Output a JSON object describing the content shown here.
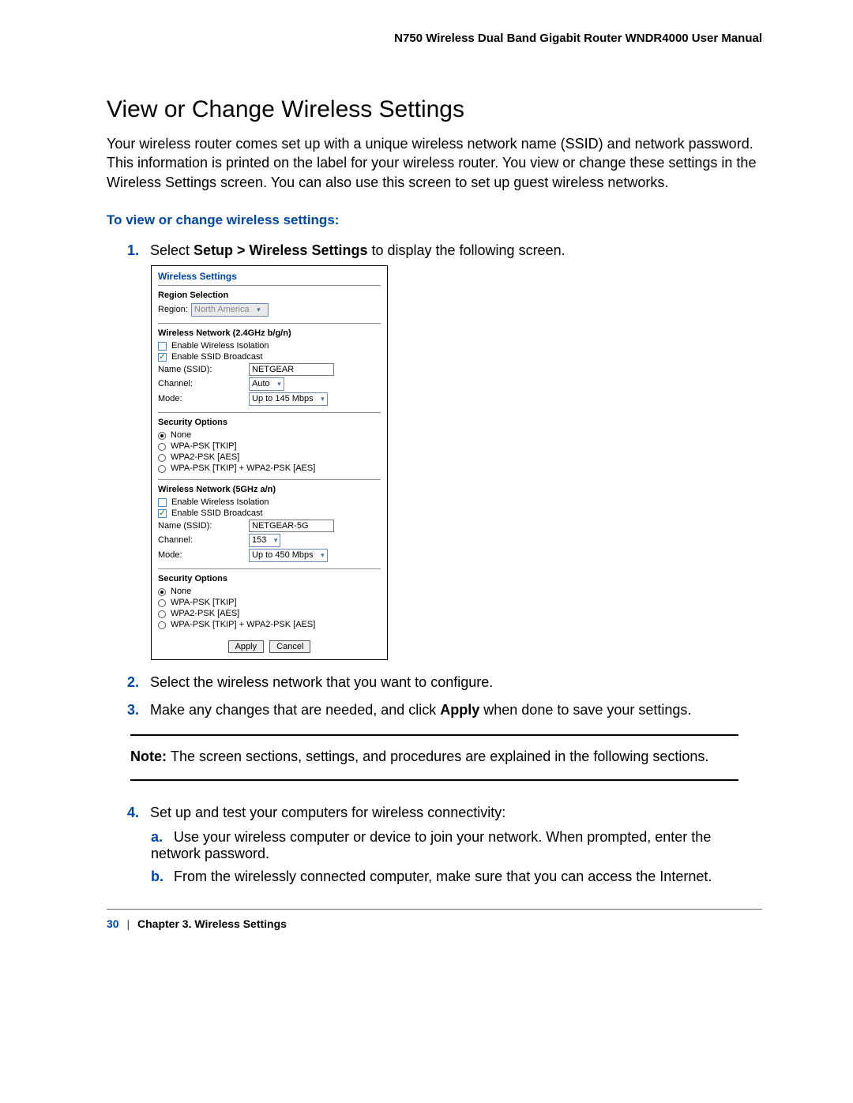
{
  "header": {
    "doc_title": "N750 Wireless Dual Band Gigabit Router WNDR4000 User Manual"
  },
  "section": {
    "title": "View or Change Wireless Settings",
    "intro": "Your wireless router comes set up with a unique wireless network name (SSID) and network password. This information is printed on the label for your wireless router. You view or change these settings in the Wireless Settings screen. You can also use this screen to set up guest wireless networks.",
    "instruction_heading": "To view or change wireless settings:"
  },
  "steps": {
    "s1a": "Select ",
    "s1b_bold": "Setup > Wireless Settings",
    "s1c": " to display the following screen.",
    "s2": "Select the wireless network that you want to configure.",
    "s3a": "Make any changes that are needed, and click ",
    "s3b_bold": "Apply",
    "s3c": " when done to save your settings.",
    "s4": "Set up and test your computers for wireless connectivity:",
    "s4a": "Use your wireless computer or device to join your network. When prompted, enter the network password.",
    "s4b": "From the wirelessly connected computer, make sure that you can access the Internet."
  },
  "note": {
    "label": "Note:  ",
    "text": "The screen sections, settings, and procedures are explained in the following sections."
  },
  "panel": {
    "title": "Wireless Settings",
    "region": {
      "heading": "Region Selection",
      "label": "Region:",
      "value": "North America"
    },
    "net24": {
      "heading": "Wireless Network (2.4GHz b/g/n)",
      "iso": "Enable Wireless Isolation",
      "ssid_broadcast": "Enable SSID Broadcast",
      "ssid_label": "Name (SSID):",
      "ssid_value": "NETGEAR",
      "channel_label": "Channel:",
      "channel_value": "Auto",
      "mode_label": "Mode:",
      "mode_value": "Up to 145 Mbps"
    },
    "sec1": {
      "heading": "Security Options",
      "opt_none": "None",
      "opt_wpa_tkip": "WPA-PSK [TKIP]",
      "opt_wpa2_aes": "WPA2-PSK [AES]",
      "opt_mixed": "WPA-PSK [TKIP] + WPA2-PSK [AES]"
    },
    "net5": {
      "heading": "Wireless Network (5GHz a/n)",
      "iso": "Enable Wireless Isolation",
      "ssid_broadcast": "Enable SSID Broadcast",
      "ssid_label": "Name (SSID):",
      "ssid_value": "NETGEAR-5G",
      "channel_label": "Channel:",
      "channel_value": "153",
      "mode_label": "Mode:",
      "mode_value": "Up to 450 Mbps"
    },
    "sec2": {
      "heading": "Security Options",
      "opt_none": "None",
      "opt_wpa_tkip": "WPA-PSK [TKIP]",
      "opt_wpa2_aes": "WPA2-PSK [AES]",
      "opt_mixed": "WPA-PSK [TKIP] + WPA2-PSK [AES]"
    },
    "buttons": {
      "apply": "Apply",
      "cancel": "Cancel"
    }
  },
  "footer": {
    "page": "30",
    "chapter": "Chapter 3.  Wireless Settings"
  }
}
